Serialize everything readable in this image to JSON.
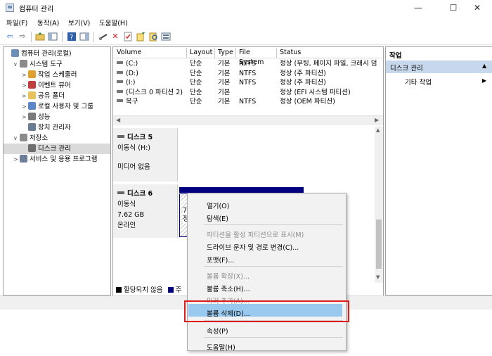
{
  "window": {
    "title": "컴퓨터 관리",
    "controls": {
      "minimize": "—",
      "maximize": "☐",
      "close": "✕"
    }
  },
  "menubar": [
    "파일(F)",
    "동작(A)",
    "보기(V)",
    "도움말(H)"
  ],
  "toolbar": [
    "back-icon",
    "forward-icon",
    "up-folder-icon",
    "show-hide-tree-icon",
    "help-icon",
    "show-hide-action-icon",
    "connect-icon",
    "delete-icon",
    "properties-icon",
    "new-icon",
    "search-icon",
    "view-icon"
  ],
  "tree": {
    "items": [
      {
        "label": "컴퓨터 관리(로컬)",
        "icon": "computer-icon",
        "level": 0,
        "toggle": ""
      },
      {
        "label": "시스템 도구",
        "icon": "tools-icon",
        "level": 1,
        "toggle": "∨"
      },
      {
        "label": "작업 스케줄러",
        "icon": "clock-icon",
        "level": 2,
        "toggle": ">"
      },
      {
        "label": "이벤트 뷰어",
        "icon": "event-viewer-icon",
        "level": 2,
        "toggle": ">"
      },
      {
        "label": "공유 폴더",
        "icon": "shared-folder-icon",
        "level": 2,
        "toggle": ">"
      },
      {
        "label": "로컬 사용자 및 그룹",
        "icon": "users-icon",
        "level": 2,
        "toggle": ">"
      },
      {
        "label": "성능",
        "icon": "performance-icon",
        "level": 2,
        "toggle": ">"
      },
      {
        "label": "장치 관리자",
        "icon": "device-manager-icon",
        "level": 2,
        "toggle": ""
      },
      {
        "label": "저장소",
        "icon": "storage-icon",
        "level": 1,
        "toggle": "∨"
      },
      {
        "label": "디스크 관리",
        "icon": "disk-management-icon",
        "level": 2,
        "toggle": "",
        "selected": true
      },
      {
        "label": "서비스 및 응용 프로그램",
        "icon": "services-icon",
        "level": 1,
        "toggle": ">"
      }
    ]
  },
  "volumes": {
    "columns": [
      "Volume",
      "Layout",
      "Type",
      "File System",
      "Status"
    ],
    "rows": [
      {
        "volume": "(C:)",
        "layout": "단순",
        "type": "기본",
        "fs": "NTFS",
        "status": "정상 (부팅, 페이지 파일, 크래시 덤"
      },
      {
        "volume": "(D:)",
        "layout": "단순",
        "type": "기본",
        "fs": "NTFS",
        "status": "정상 (주 파티션)"
      },
      {
        "volume": "(I:)",
        "layout": "단순",
        "type": "기본",
        "fs": "NTFS",
        "status": "정상 (주 파티션)"
      },
      {
        "volume": "(디스크 0 파티션 2)",
        "layout": "단순",
        "type": "기본",
        "fs": "",
        "status": "정상 (EFI 시스템 파티션)"
      },
      {
        "volume": "복구",
        "layout": "단순",
        "type": "기본",
        "fs": "NTFS",
        "status": "정상 (OEM 파티션)"
      }
    ]
  },
  "disks": [
    {
      "name": "디스크 5",
      "kind": "이동식 (H:)",
      "size": "",
      "state": "미디어 없음"
    },
    {
      "name": "디스크 6",
      "kind": "이동식",
      "size": "7.62 GB",
      "state": "온라인",
      "partition_fragment": [
        "7",
        "정"
      ]
    }
  ],
  "legend": [
    {
      "label": "할당되지 않음",
      "color": "#000000"
    },
    {
      "label": "주",
      "color": "#000080"
    }
  ],
  "context_menu": {
    "items": [
      {
        "label": "열기(O)",
        "disabled": false
      },
      {
        "label": "탐색(E)",
        "disabled": false
      },
      {
        "separator": true
      },
      {
        "label": "파티션을 활성 파티션으로 표시(M)",
        "disabled": true
      },
      {
        "label": "드라이브 문자 및 경로 변경(C)...",
        "disabled": false
      },
      {
        "label": "포맷(F)...",
        "disabled": false
      },
      {
        "separator": true
      },
      {
        "label": "볼륨 확장(X)...",
        "disabled": true
      },
      {
        "label": "볼륨 축소(H)...",
        "disabled": false
      },
      {
        "label": "미러 추가(A)...",
        "disabled": true
      },
      {
        "label": "볼륨 삭제(D)...",
        "disabled": false,
        "highlighted": true
      },
      {
        "separator": true
      },
      {
        "label": "속성(P)",
        "disabled": false
      },
      {
        "separator": true
      },
      {
        "label": "도움말(H)",
        "disabled": false
      }
    ]
  },
  "actions": {
    "header": "작업",
    "section": "디스크 관리",
    "section_arrow": "▲",
    "item": "기타 작업",
    "item_arrow": "▶"
  },
  "colors": {
    "selection": "#99c9ef",
    "highlight_box": "#e01b1b",
    "primary_partition": "#000080",
    "action_section": "#c7d8ec"
  }
}
